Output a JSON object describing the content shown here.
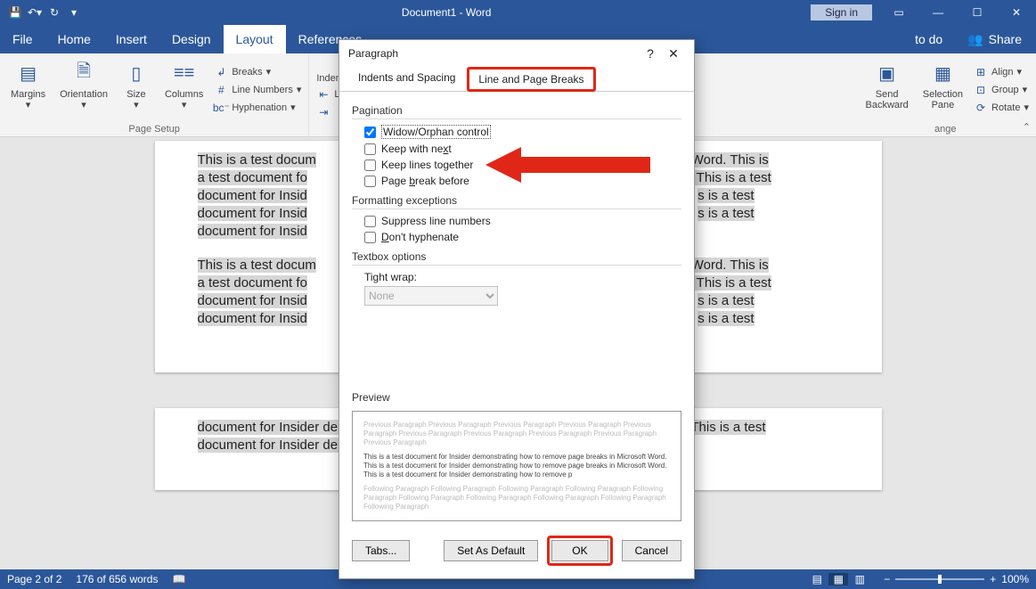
{
  "titlebar": {
    "title": "Document1 - Word",
    "signin": "Sign in"
  },
  "menubar": {
    "tabs": [
      "File",
      "Home",
      "Insert",
      "Design",
      "Layout",
      "References"
    ],
    "active": "Layout",
    "todo": "to do",
    "share": "Share"
  },
  "ribbon": {
    "page_setup": {
      "label": "Page Setup",
      "margins": "Margins",
      "orientation": "Orientation",
      "size": "Size",
      "columns": "Columns",
      "breaks": "Breaks",
      "line_numbers": "Line Numbers",
      "hyphenation": "Hyphenation"
    },
    "indent_frag": "Indent",
    "le_frag": "Le",
    "arrange": {
      "label": "ange",
      "send_backward": "Send\nBackward",
      "selection_pane": "Selection\nPane",
      "align": "Align",
      "group": "Group",
      "rotate": "Rotate"
    }
  },
  "document": {
    "p1_lines": [
      "This is a test docum",
      "a test document fo",
      "document for Insid",
      "document for Insid",
      "document for Insid"
    ],
    "p1_tails": [
      "ft Word. This is",
      "d. This is a test",
      "s is a test",
      "s is a test",
      ""
    ],
    "p2_lines": [
      "This is a test docum",
      "a test document fo",
      "document for Insid",
      "document for Insid"
    ],
    "p2_tails": [
      "ft Word. This is",
      "d. This is a test",
      "s is a test",
      "s is a test"
    ],
    "page2_l1": "document for Insider demonstrating how to remove page breaks in Microsoft Word. This is a test",
    "page2_l2": "document for Insider demonstrating how to remove page breaks in Microsoft Word."
  },
  "dialog": {
    "title": "Paragraph",
    "tab_indents": "Indents and Spacing",
    "tab_lpb": "Line and Page Breaks",
    "pagination": "Pagination",
    "widow": "Widow/Orphan control",
    "keep_next": "Keep with next",
    "keep_lines": "Keep lines together",
    "page_break_before": "Page break before",
    "formatting_exceptions": "Formatting exceptions",
    "suppress": "Suppress line numbers",
    "dont_hyphenate": "Don't hyphenate",
    "textbox_options": "Textbox options",
    "tight_wrap": "Tight wrap:",
    "tight_wrap_value": "None",
    "preview_label": "Preview",
    "preview_prev": "Previous Paragraph Previous Paragraph Previous Paragraph Previous Paragraph Previous Paragraph Previous Paragraph Previous Paragraph Previous Paragraph Previous Paragraph Previous Paragraph",
    "preview_curr": "This is a test document for Insider demonstrating how to remove page breaks in Microsoft Word. This is a test document for Insider demonstrating how to remove page breaks in Microsoft Word. This is a test document for Insider demonstrating how to remove p",
    "preview_next": "Following Paragraph Following Paragraph Following Paragraph Following Paragraph Following Paragraph Following Paragraph Following Paragraph Following Paragraph Following Paragraph Following Paragraph",
    "tabs_btn": "Tabs...",
    "default_btn": "Set As Default",
    "ok_btn": "OK",
    "cancel_btn": "Cancel"
  },
  "statusbar": {
    "page": "Page 2 of 2",
    "words": "176 of 656 words",
    "zoom": "100%"
  }
}
